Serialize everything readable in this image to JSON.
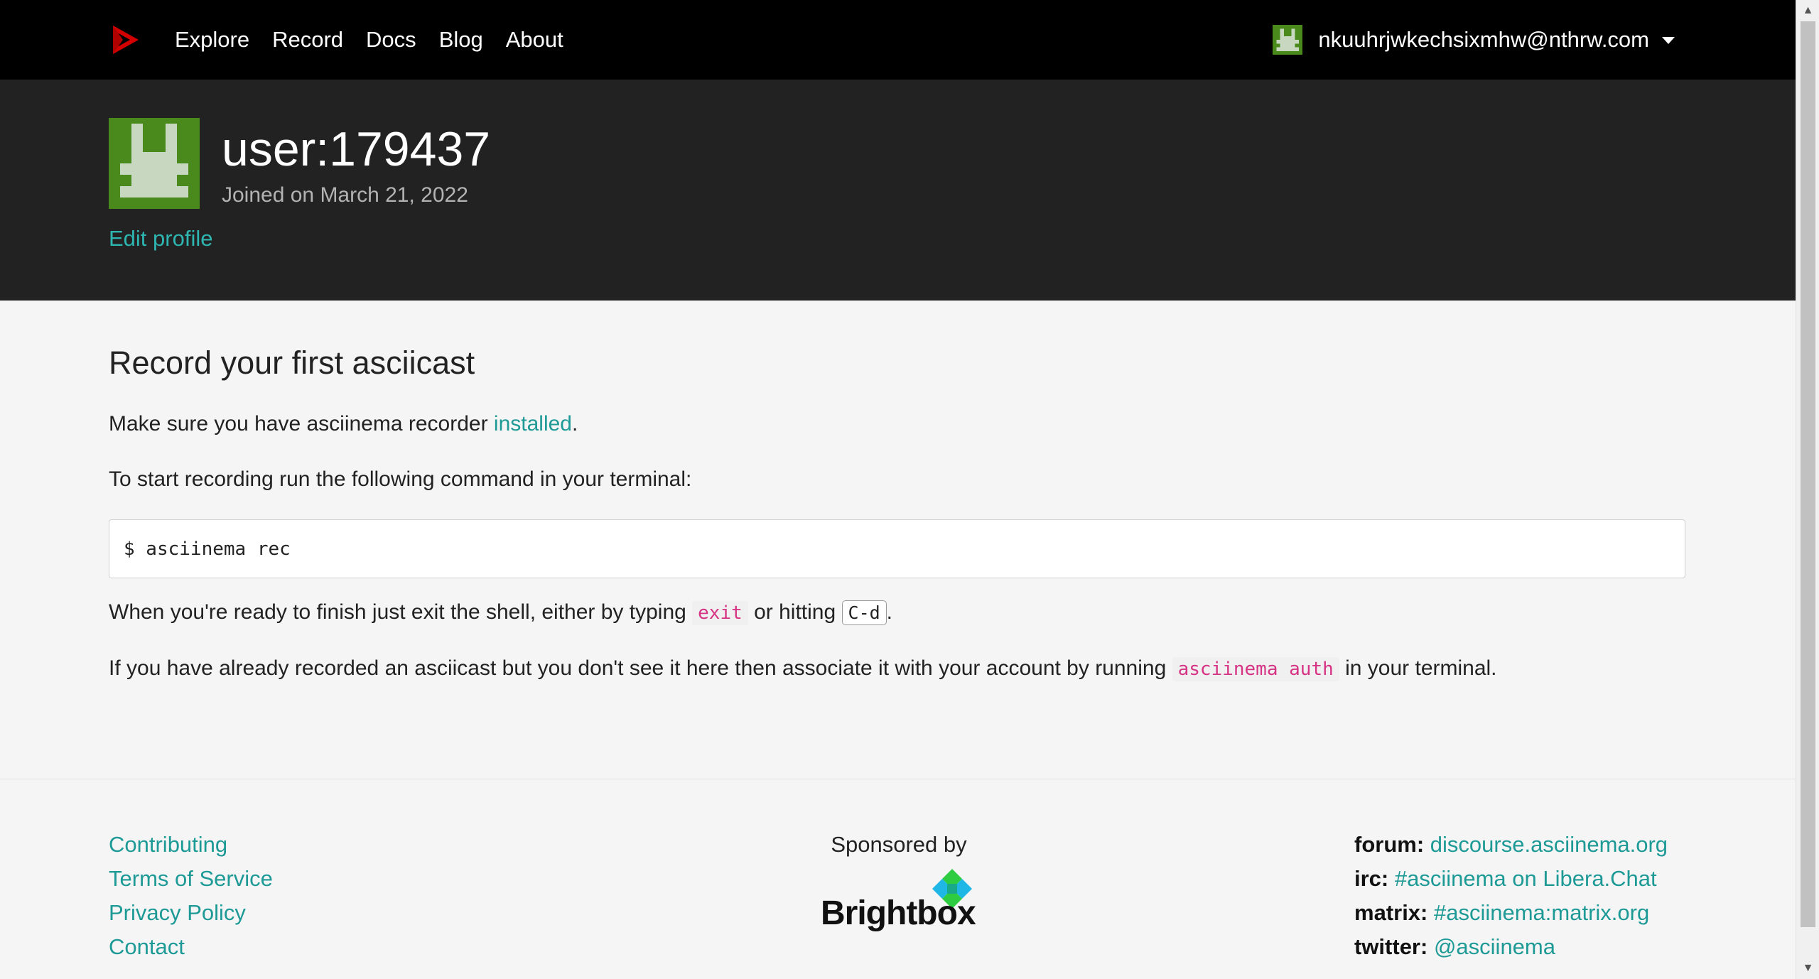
{
  "nav": {
    "links": [
      "Explore",
      "Record",
      "Docs",
      "Blog",
      "About"
    ],
    "user_email": "nkuuhrjwkechsixmhw@nthrw.com"
  },
  "profile": {
    "username": "user:179437",
    "joined": "Joined on March 21, 2022",
    "edit_label": "Edit profile"
  },
  "main": {
    "heading": "Record your first asciicast",
    "p1_prefix": "Make sure you have asciinema recorder ",
    "p1_link": "installed",
    "p1_suffix": ".",
    "p2": "To start recording run the following command in your terminal:",
    "command": "$ asciinema rec",
    "p3_prefix": "When you're ready to finish just exit the shell, either by typing ",
    "p3_code": "exit",
    "p3_middle": " or hitting ",
    "p3_kbd": "C-d",
    "p3_suffix": ".",
    "p4_prefix": "If you have already recorded an asciicast but you don't see it here then associate it with your account by running ",
    "p4_code": "asciinema auth",
    "p4_suffix": " in your terminal."
  },
  "footer": {
    "links": [
      "Contributing",
      "Terms of Service",
      "Privacy Policy",
      "Contact"
    ],
    "sponsored_by": "Sponsored by",
    "sponsor_name": "Brightbox",
    "community": [
      {
        "label": "forum:",
        "value": "discourse.asciinema.org"
      },
      {
        "label": "irc:",
        "value": "#asciinema on Libera.Chat"
      },
      {
        "label": "matrix:",
        "value": "#asciinema:matrix.org"
      },
      {
        "label": "twitter:",
        "value": "@asciinema"
      }
    ]
  },
  "colors": {
    "navbar_bg": "#000000",
    "header_bg": "#222222",
    "page_bg": "#f5f5f5",
    "link": "#1e9a96",
    "logo_red": "#d40000",
    "avatar_green": "#4a8a1c",
    "code_pink": "#d63384"
  },
  "icons": {
    "logo": "asciinema-logo-icon",
    "caret": "caret-down-icon"
  }
}
